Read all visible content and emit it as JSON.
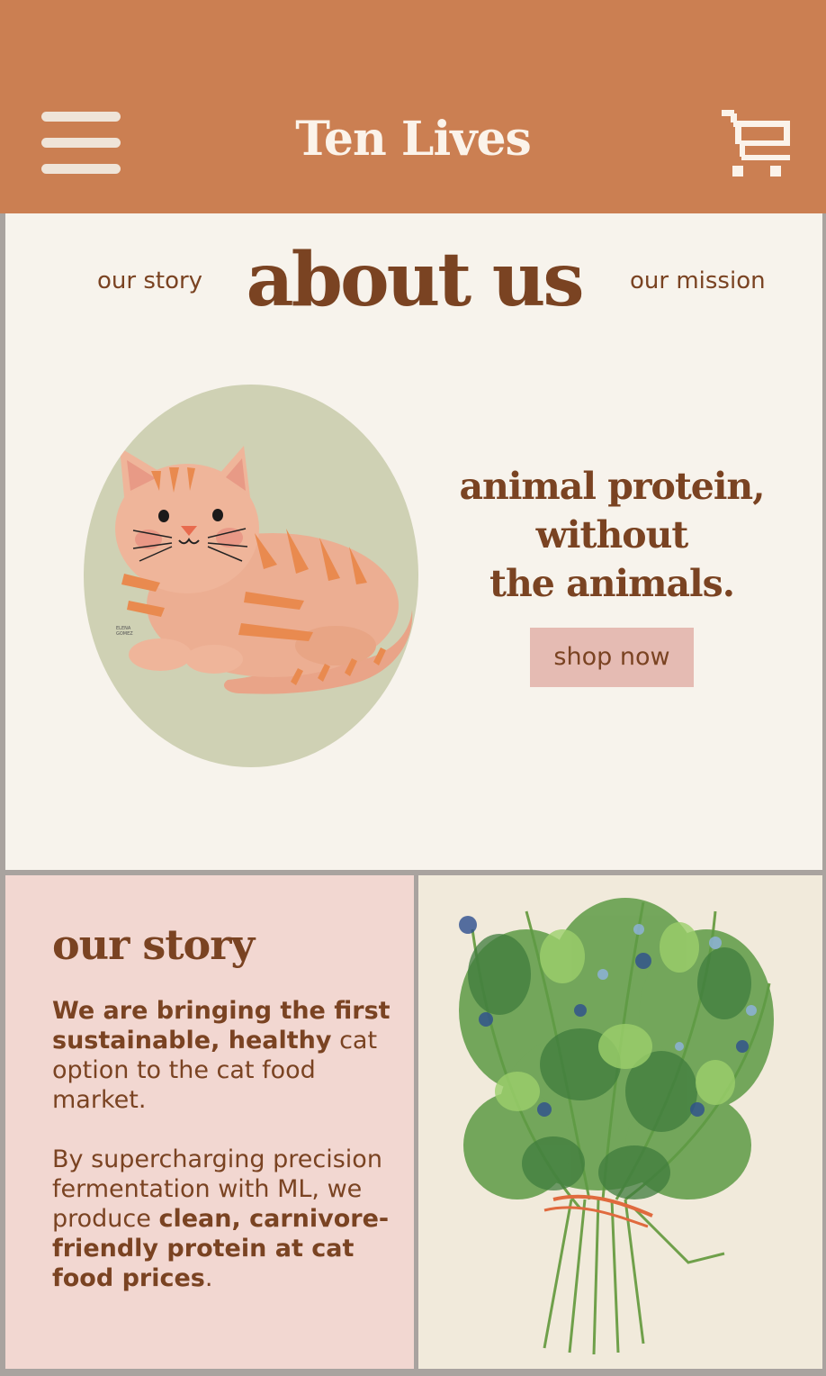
{
  "header": {
    "brand": "Ten Lives",
    "menu_icon": "hamburger-menu-icon",
    "cart_icon": "shopping-cart-icon"
  },
  "nav": {
    "left_link": "our story",
    "right_link": "our mission"
  },
  "hero": {
    "title": "about us",
    "tagline_lines": [
      "animal protein,",
      "without",
      "the animals."
    ],
    "cta_label": "shop now",
    "illustration": "orange-tabby-cat-illustration",
    "artist_signature": "ELENA GOMEZ"
  },
  "story": {
    "heading": "our story",
    "p1_bold": "We are bringing the first sustainable, healthy",
    "p1_rest": " cat option to the cat food market.",
    "p2_start": "By supercharging precision fermentation with ML, we  produce ",
    "p2_bold": "clean, carnivore-friendly protein at cat food prices",
    "p2_end": ".",
    "illustration": "herb-bouquet-illustration"
  },
  "colors": {
    "header_bg": "#cb7f52",
    "brand_text": "#fbf3ea",
    "accent_brown": "#7a4322",
    "hero_bg": "#f7f3ec",
    "button_bg": "#e5bbb3",
    "story_bg": "#f2d7d1",
    "oval_bg": "#cfd1b4"
  }
}
